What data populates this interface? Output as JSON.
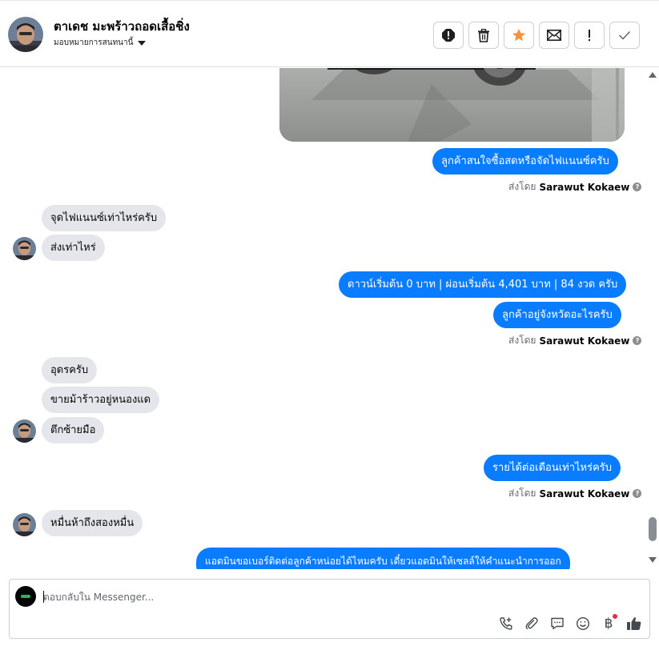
{
  "header": {
    "contact_name": "ตาเดช มะพร้าวถอดเสื้อชิ่ง",
    "assign_label": "มอบหมายการสนทนานี้",
    "actions": [
      {
        "name": "mark-spam-button",
        "icon": "alert-octagon-icon"
      },
      {
        "name": "delete-button",
        "icon": "trash-icon"
      },
      {
        "name": "star-button",
        "icon": "star-icon",
        "color": "#f7923b"
      },
      {
        "name": "mark-unread-button",
        "icon": "envelope-icon"
      },
      {
        "name": "follow-up-button",
        "icon": "exclamation-icon"
      },
      {
        "name": "done-button",
        "icon": "checkmark-icon"
      }
    ]
  },
  "messages": {
    "m1": "ลูกค้าสนใจซื้อสดหรือจัดไฟแนนซ์ครับ",
    "sent1_prefix": "ส่งโดย",
    "sent1_name": "Sarawut Kokaew",
    "m2": "จุดไฟแนนซ์เท่าไหร่ครับ",
    "m3": "ส่งเท่าไหร่",
    "m4": "ดาวน์เริ่มต้น 0 บาท | ผ่อนเริ่มต้น 4,401 บาท | 84 งวด ครับ",
    "m5": "ลูกค้าอยู่จังหวัดอะไรครับ",
    "sent2_prefix": "ส่งโดย",
    "sent2_name": "Sarawut Kokaew",
    "m6": "อุดรครับ",
    "m7": "ขายม้าร้าวอยู่หนองแด",
    "m8": "ตึกซ้ายมือ",
    "m9": "รายได้ต่อเดือนเท่าไหร่ครับ",
    "sent3_prefix": "ส่งโดย",
    "sent3_name": "Sarawut Kokaew",
    "m10": "หมื่นห้าถึงสองหมื่น",
    "m11": "แอดมินขอเบอร์ติดต่อลูกค้าหน่อยได้ไหมครับ เดี๋ยวแอดมินให้เซลล์ให้คำแนะนำการออก"
  },
  "composer": {
    "placeholder": "ตอบกลับใน Messenger...",
    "tools": [
      "call-add-icon",
      "paperclip-icon",
      "speech-bubble-icon",
      "emoji-icon",
      "baht-icon",
      "thumbs-up-icon"
    ],
    "baht_symbol": "฿"
  },
  "colors": {
    "outgoing": "#0a7cff",
    "incoming": "#e4e6eb",
    "star": "#f7923b"
  }
}
